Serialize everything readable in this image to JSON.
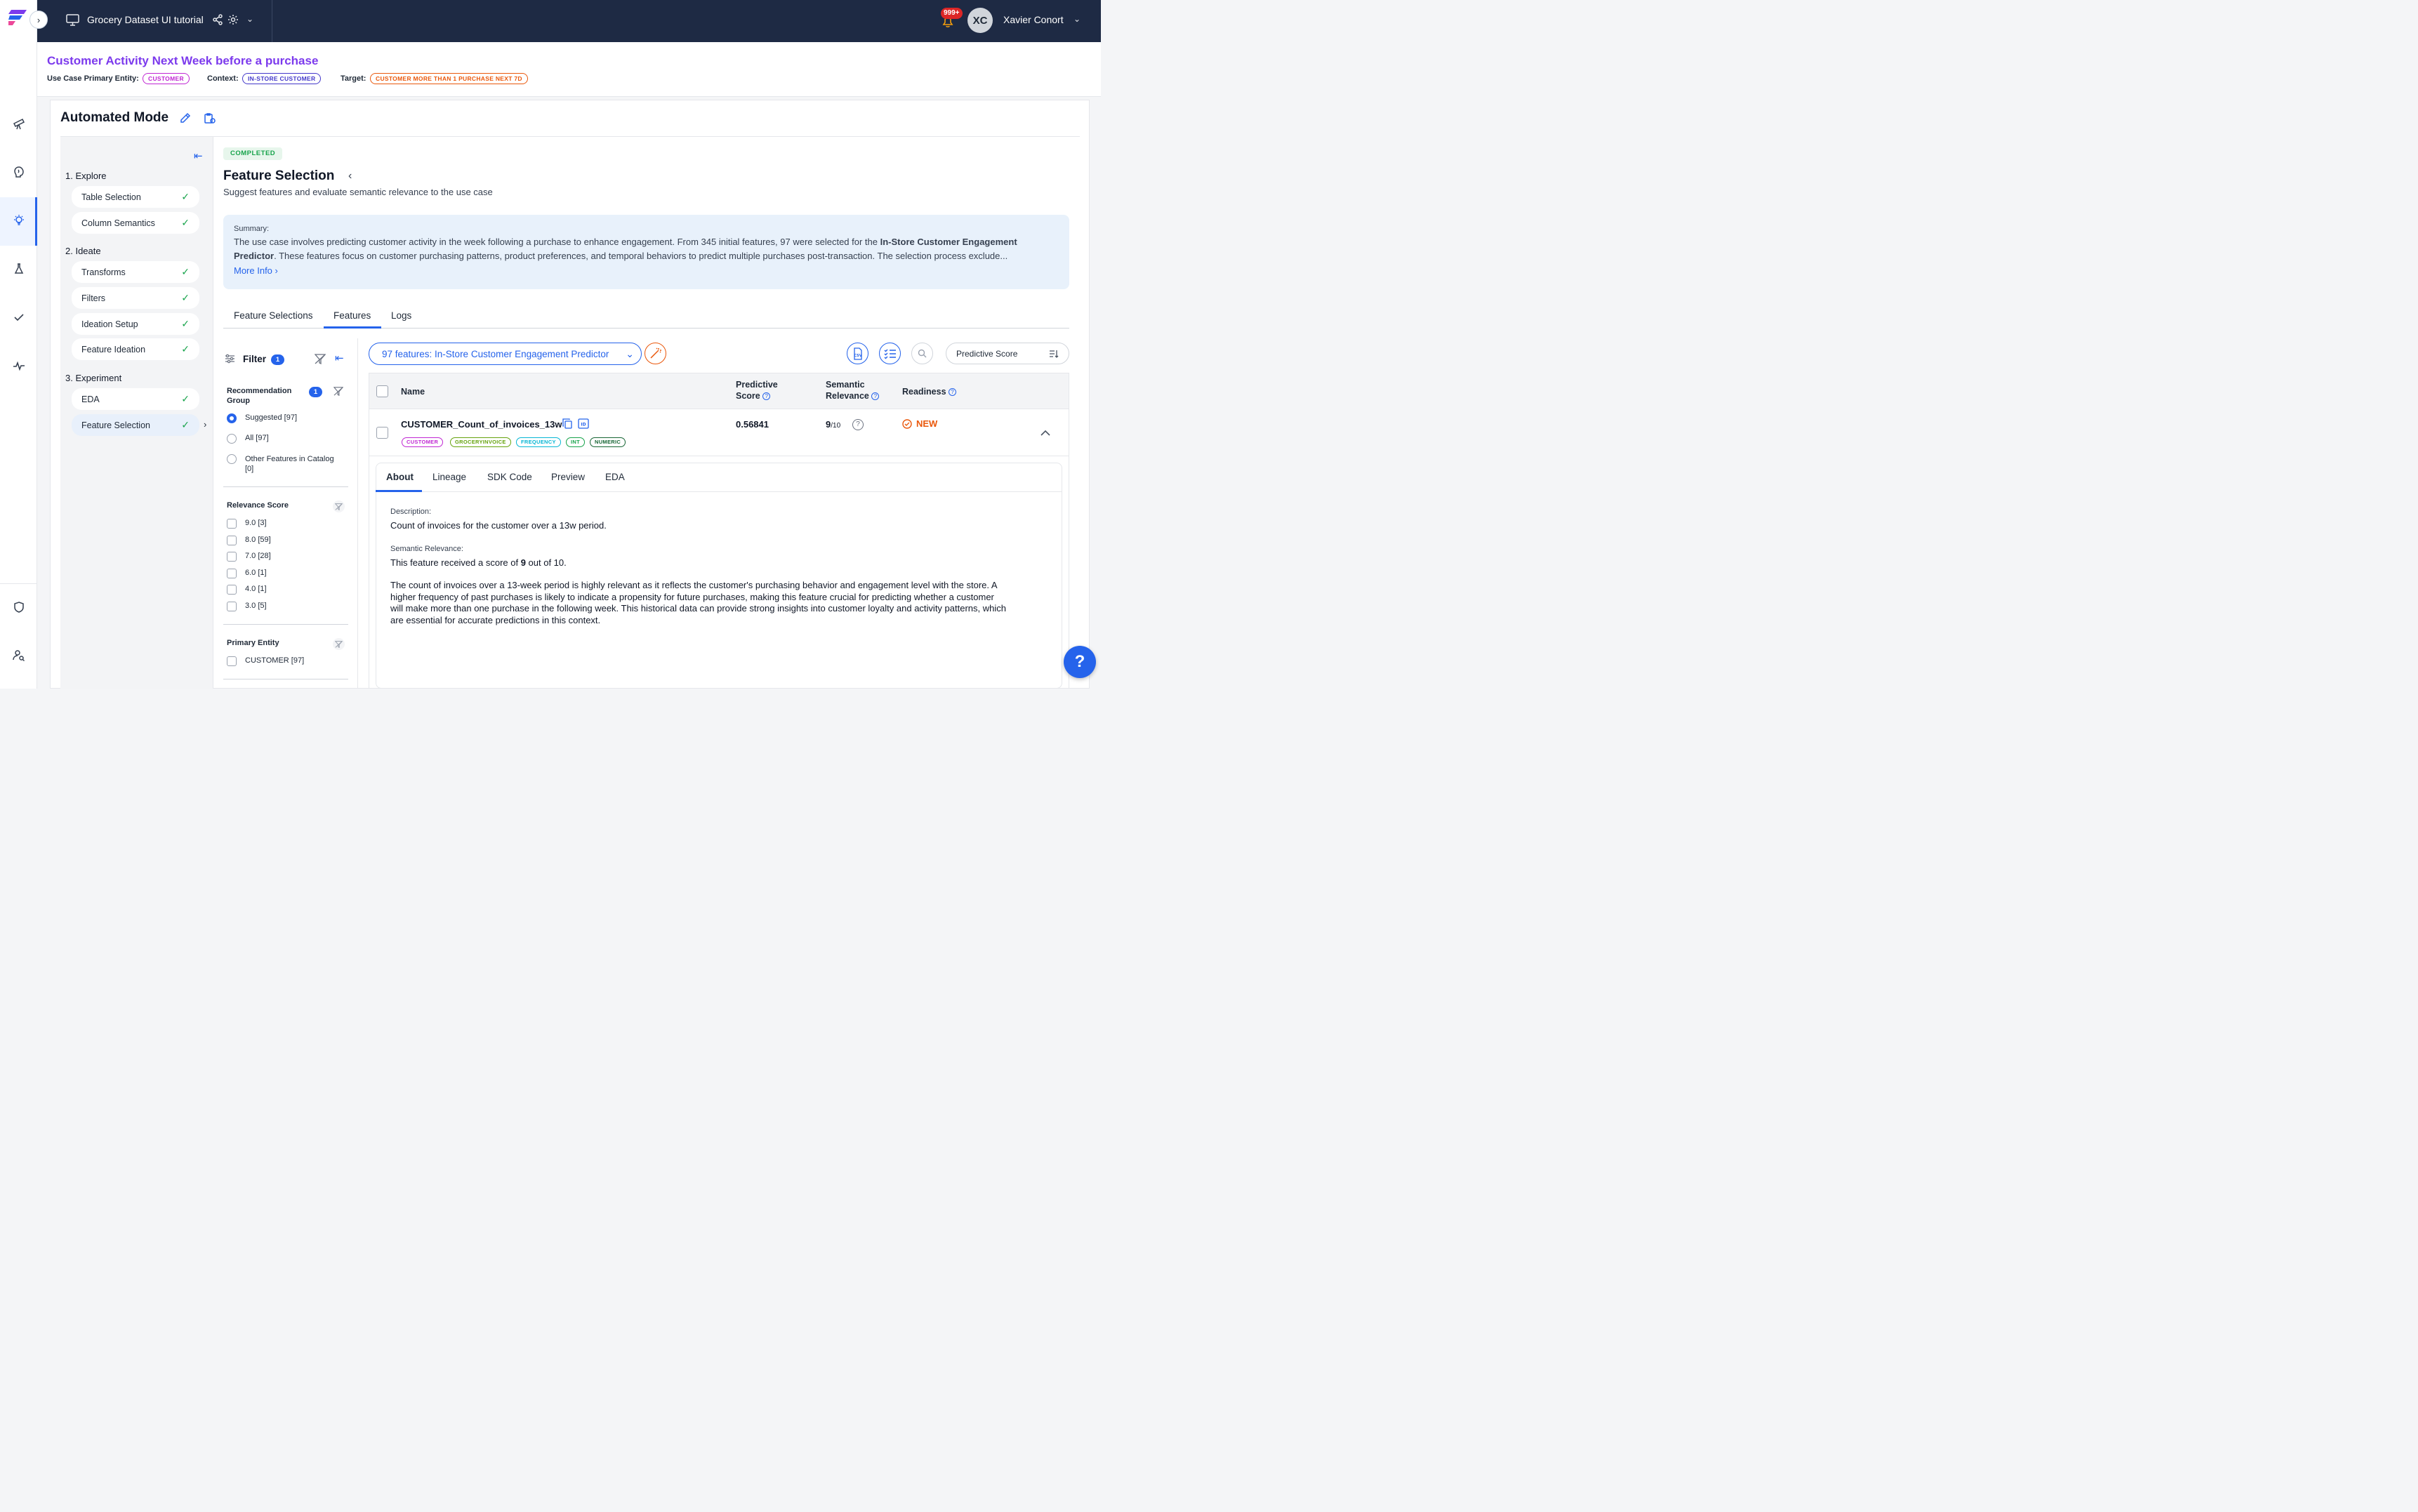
{
  "header": {
    "project_title": "Grocery Dataset UI tutorial",
    "notifications_count": "999+",
    "user_initials": "XC",
    "user_name": "Xavier Conort"
  },
  "use_case": {
    "title": "Customer Activity Next Week before a purchase",
    "primary_entity_label": "Use Case Primary Entity:",
    "primary_entity": "CUSTOMER",
    "context_label": "Context:",
    "context": "IN-STORE CUSTOMER",
    "target_label": "Target:",
    "target": "CUSTOMER MORE THAN 1 PURCHASE NEXT 7D"
  },
  "mode": {
    "title": "Automated Mode"
  },
  "steps": {
    "groups": [
      {
        "label": "1. Explore",
        "items": [
          "Table Selection",
          "Column Semantics"
        ]
      },
      {
        "label": "2. Ideate",
        "items": [
          "Transforms",
          "Filters",
          "Ideation Setup",
          "Feature Ideation"
        ]
      },
      {
        "label": "3. Experiment",
        "items": [
          "EDA",
          "Feature Selection"
        ]
      }
    ]
  },
  "feature_selection": {
    "status": "COMPLETED",
    "title": "Feature Selection",
    "subtitle": "Suggest features and evaluate semantic relevance to the use case",
    "summary_label": "Summary:",
    "summary_prefix": "The use case involves predicting customer activity in the week following a purchase to enhance engagement. From 345 initial features, 97 were selected for the ",
    "summary_bold": "In-Store Customer Engagement Predictor",
    "summary_suffix": ". These features focus on customer purchasing patterns, product preferences, and temporal behaviors to predict multiple purchases post-transaction. The selection process exclude...",
    "more_info": "More Info",
    "tabs": [
      "Feature Selections",
      "Features",
      "Logs"
    ],
    "active_tab": "Features"
  },
  "filter": {
    "title": "Filter",
    "count": "1",
    "recommendation": {
      "label_line1": "Recommendation",
      "label_line2": "Group",
      "count": "1",
      "options": [
        "Suggested [97]",
        "All [97]",
        "Other Features in Catalog",
        "[0]"
      ]
    },
    "relevance": {
      "label": "Relevance Score",
      "options": [
        "9.0 [3]",
        "8.0 [59]",
        "7.0 [28]",
        "6.0 [1]",
        "4.0 [1]",
        "3.0 [5]"
      ]
    },
    "primary_entity": {
      "label": "Primary Entity",
      "options": [
        "CUSTOMER [97]"
      ]
    }
  },
  "feature_list": {
    "selector": "97 features: In-Store Customer Engagement Predictor",
    "sort_by": "Predictive Score",
    "columns": {
      "name": "Name",
      "predictive_1": "Predictive",
      "predictive_2": "Score",
      "semantic_1": "Semantic",
      "semantic_2": "Relevance",
      "readiness": "Readiness"
    },
    "rows": [
      {
        "name": "CUSTOMER_Count_of_invoices_13w",
        "tags": [
          "CUSTOMER",
          "GROCERYINVOICE",
          "FREQUENCY",
          "INT",
          "NUMERIC"
        ],
        "predictive_score": "0.56841",
        "semantic_score": "9",
        "semantic_max": "/10",
        "readiness": "NEW"
      }
    ]
  },
  "detail": {
    "tabs": [
      "About",
      "Lineage",
      "SDK Code",
      "Preview",
      "EDA"
    ],
    "active_tab": "About",
    "description_label": "Description:",
    "description": "Count of invoices for the customer over a 13w period.",
    "semantic_label": "Semantic Relevance:",
    "semantic_prefix": "This feature received a score of ",
    "semantic_score": "9",
    "semantic_suffix": " out of 10.",
    "explanation_lines": [
      "The count of invoices over a 13-week period is highly relevant as it reflects the customer's purchasing behavior and engagement level with the store. A",
      "higher frequency of past purchases is likely to indicate a propensity for future purchases, making this feature crucial for predicting whether a customer",
      "will make more than one purchase in the following week. This historical data can provide strong insights into customer loyalty and activity patterns, which",
      "are essential for accurate predictions in this context."
    ]
  },
  "help_fab": "?",
  "colors": {
    "accent": "#2563eb",
    "purple": "#7c3aed",
    "orange": "#ea580c",
    "success": "#16a34a",
    "header_bg": "#1e2a44"
  }
}
